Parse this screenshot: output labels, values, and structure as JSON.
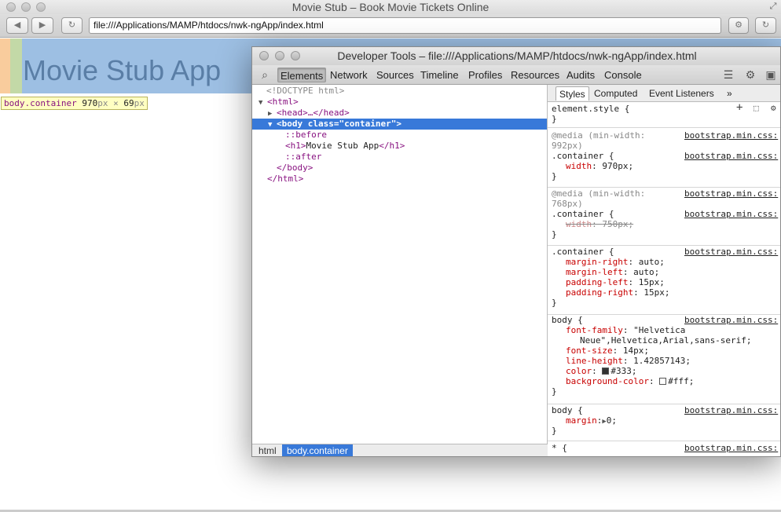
{
  "window": {
    "title": "Movie Stub – Book Movie Tickets Online"
  },
  "toolbar": {
    "url": "file:///Applications/MAMP/htdocs/nwk-ngApp/index.html",
    "back_icon": "back-arrow",
    "forward_icon": "forward-arrow",
    "reload_icon": "reload"
  },
  "page": {
    "heading": "Movie Stub App",
    "tooltip": {
      "selector": "body.container",
      "width": "970",
      "height": "69",
      "unit": "px",
      "times": "×"
    }
  },
  "devtools": {
    "title": "Developer Tools – file:///Applications/MAMP/htdocs/nwk-ngApp/index.html",
    "tabs": [
      "Elements",
      "Network",
      "Sources",
      "Timeline",
      "Profiles",
      "Resources",
      "Audits",
      "Console"
    ],
    "active_tab": "Elements",
    "dom": {
      "doctype": "<!DOCTYPE html>",
      "html_open": "<html>",
      "head": "<head>…</head>",
      "body_tag": "body",
      "body_attr": "class",
      "body_val": "\"container\"",
      "before": "::before",
      "h1_open": "<h1>",
      "h1_text": "Movie Stub App",
      "h1_close": "</h1>",
      "after": "::after",
      "body_close": "</body>",
      "html_close": "</html>"
    },
    "breadcrumbs": [
      "html",
      "body.container"
    ],
    "sidebar_tabs": [
      "Styles",
      "Computed",
      "Event Listeners"
    ],
    "sidebar_more": "»",
    "styles": {
      "element_style": "element.style {",
      "close": "}",
      "source": "bootstrap.min.css:",
      "media992_1": "@media (min-width:",
      "media992_2": "992px)",
      "media768_1": "@media (min-width:",
      "media768_2": "768px)",
      "container_sel": ".container {",
      "width970_name": "width",
      "width970_val": "970px;",
      "width750_name": "width",
      "width750_val": "750px;",
      "margin_right_name": "margin-right",
      "margin_right_val": "auto;",
      "margin_left_name": "margin-left",
      "margin_left_val": "auto;",
      "padding_left_name": "padding-left",
      "padding_left_val": "15px;",
      "padding_right_name": "padding-right",
      "padding_right_val": "15px;",
      "body_sel": "body {",
      "font_family_name": "font-family",
      "font_family_val1": "\"Helvetica",
      "font_family_val2": "Neue\",Helvetica,Arial,sans-serif;",
      "font_size_name": "font-size",
      "font_size_val": "14px;",
      "line_height_name": "line-height",
      "line_height_val": "1.42857143;",
      "color_name": "color",
      "color_val": "#333;",
      "bg_name": "background-color",
      "bg_val": "#fff;",
      "margin_name": "margin",
      "margin_val": "0;",
      "star_sel": "* {"
    }
  },
  "colors": {
    "selection": "#3879d9",
    "highlight_content": "#9dbfe3",
    "highlight_padding": "#c3d9a7",
    "highlight_margin": "#f9cc9d",
    "swatch_text": "#333",
    "swatch_bg": "#fff"
  }
}
